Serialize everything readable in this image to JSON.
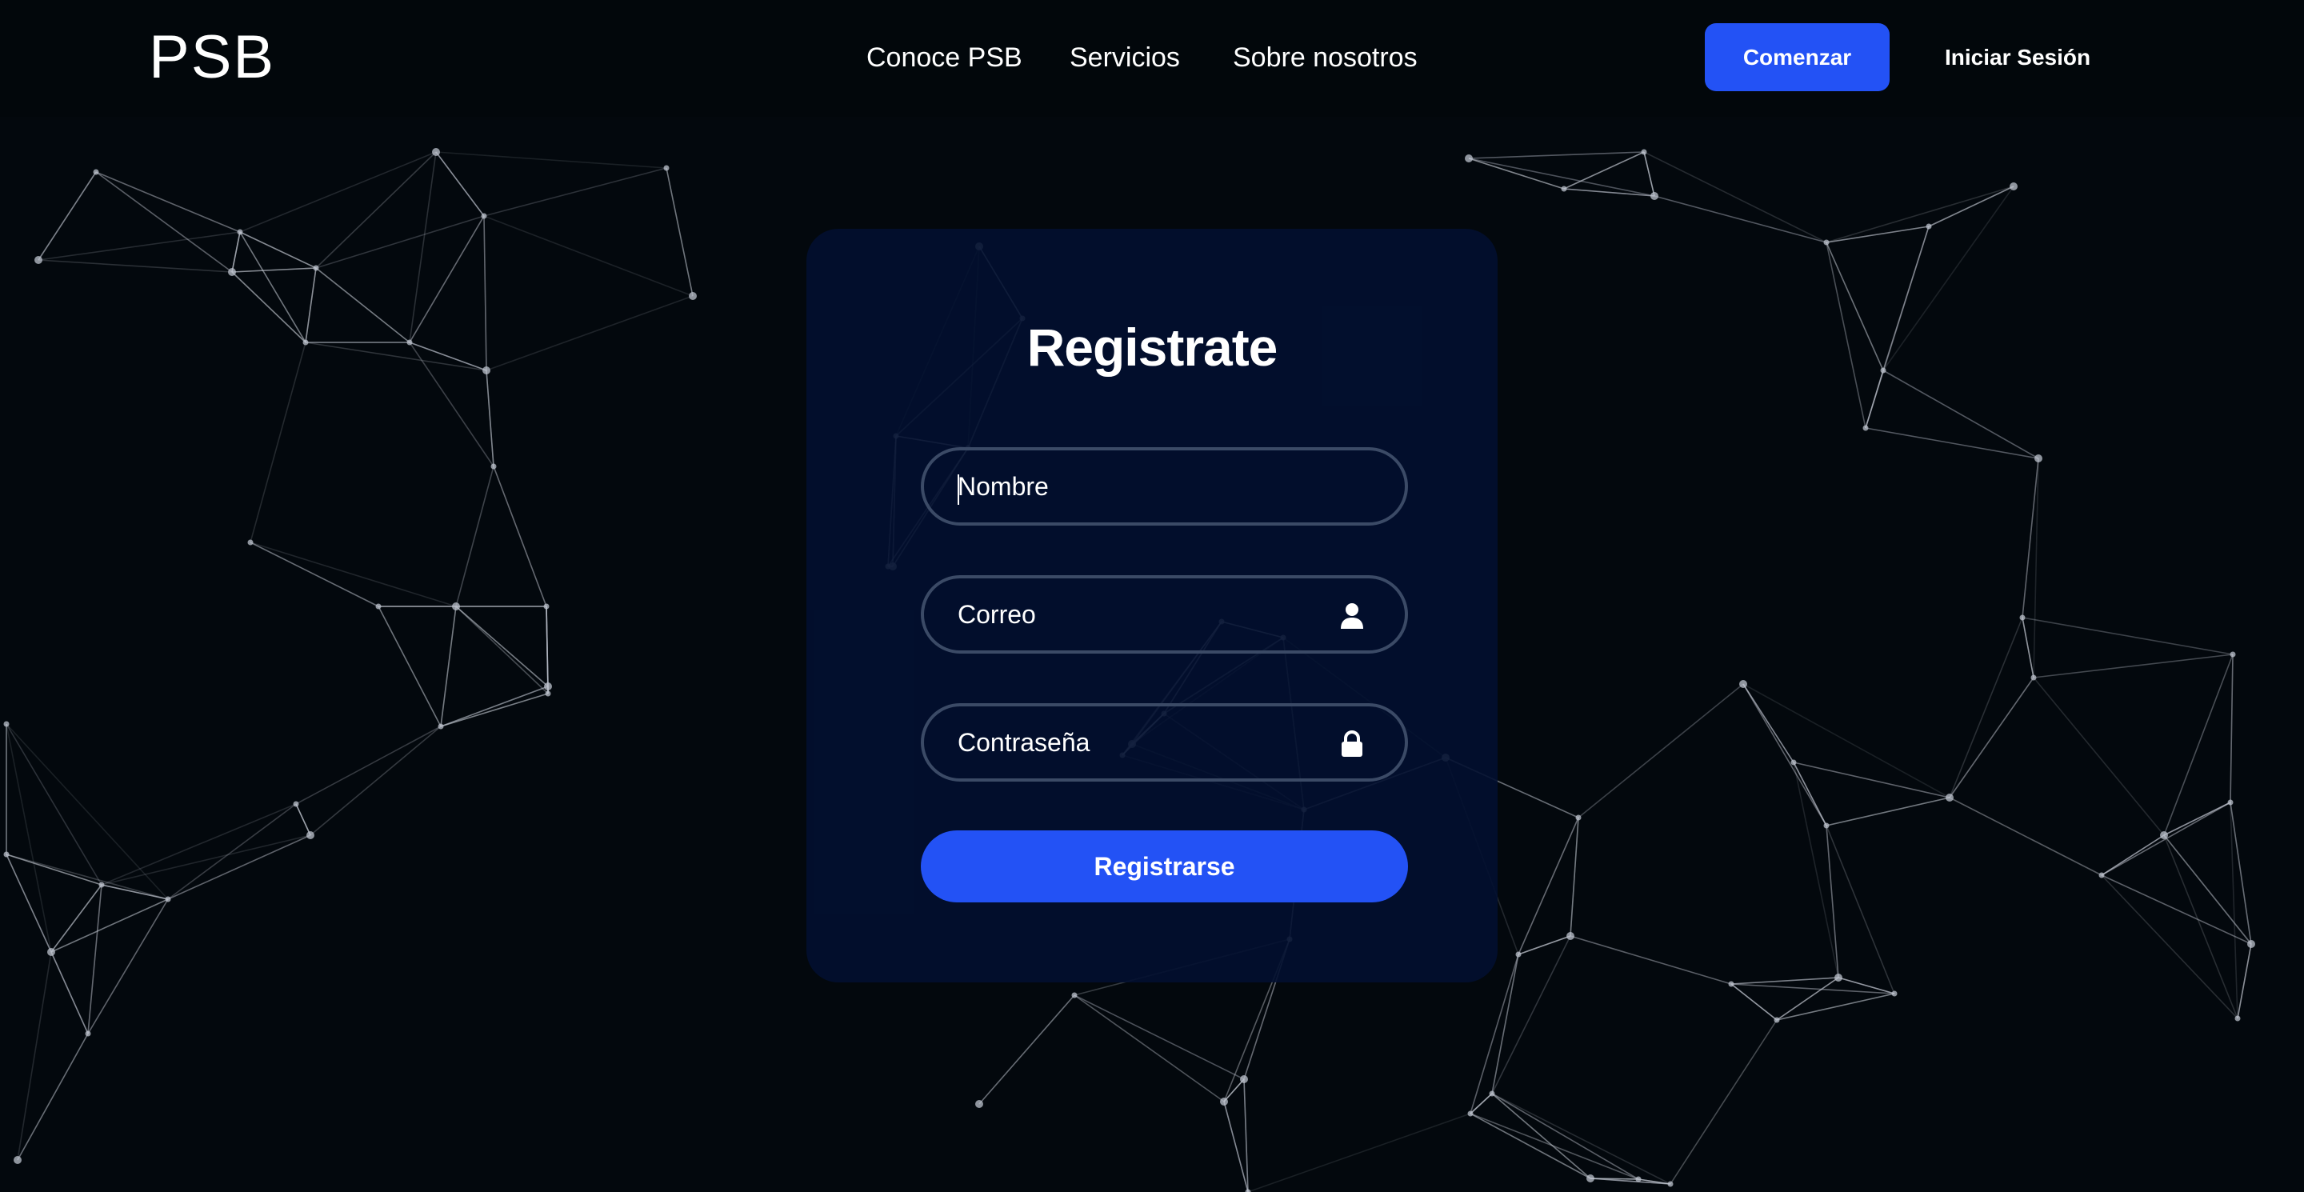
{
  "header": {
    "logo": "PSB",
    "nav": [
      "Conoce PSB",
      "Servicios",
      "Sobre nosotros"
    ],
    "start_button": "Comenzar",
    "login_link": "Iniciar Sesión"
  },
  "form": {
    "title": "Registrate",
    "name_placeholder": "Nombre",
    "email_placeholder": "Correo",
    "password_placeholder": "Contraseña",
    "submit": "Registrarse",
    "email_icon": "user-icon",
    "password_icon": "lock-icon"
  },
  "colors": {
    "background": "#03080d",
    "card": "#021030",
    "accent": "#2352f5",
    "field_border": "#3b4a66"
  }
}
